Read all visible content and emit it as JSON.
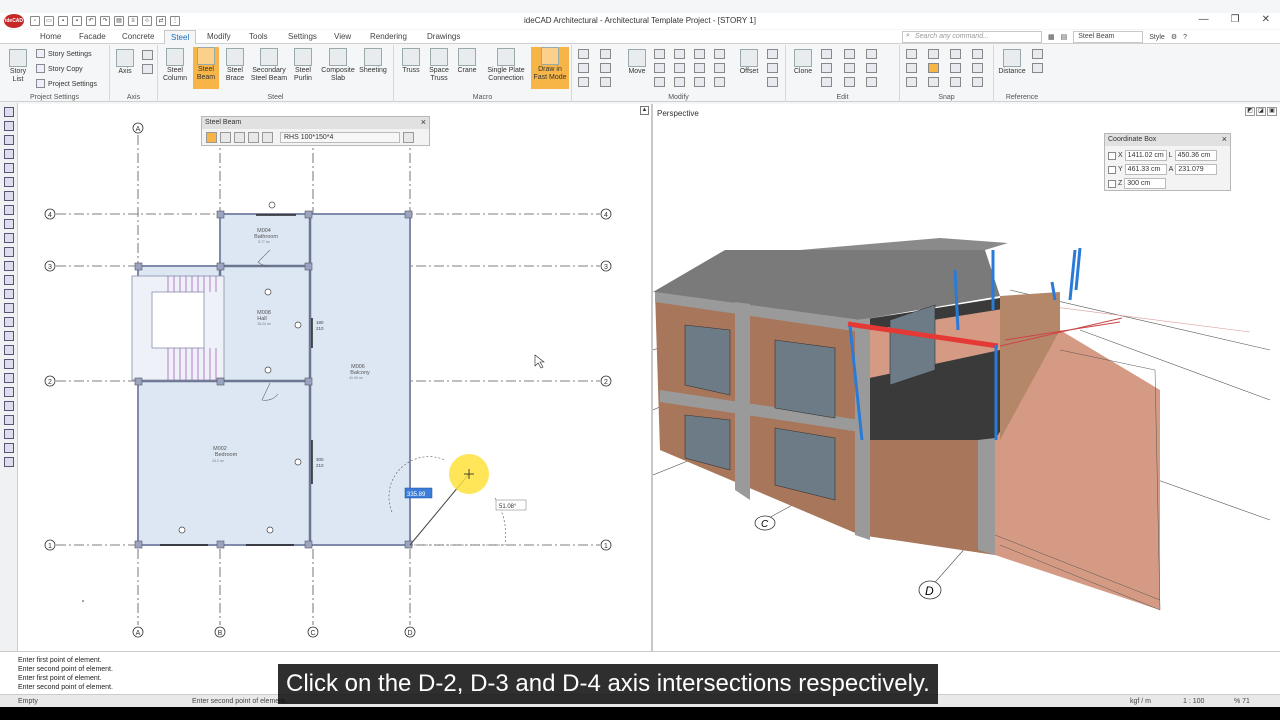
{
  "app": {
    "title": "ideCAD Architectural - Architectural Template Project - [STORY 1]",
    "logo_text": "ideCAD",
    "window_controls": [
      "—",
      "❐",
      "✕"
    ]
  },
  "tabs": [
    "Home",
    "Facade",
    "Concrete",
    "Steel",
    "Modify",
    "Tools",
    "Settings",
    "View",
    "Rendering",
    "Drawings"
  ],
  "active_tab": "Steel",
  "search": {
    "placeholder": "Search any command..."
  },
  "right_tools": {
    "selector_value": "Steel Beam",
    "style_label": "Style"
  },
  "ribbon": {
    "project_settings": {
      "label": "Project Settings",
      "story_list": "Story List",
      "story_settings": "Story Settings",
      "story_copy": "Story Copy",
      "project_settings_btn": "Project Settings"
    },
    "axis": {
      "label": "Axis",
      "axis_btn": "Axis"
    },
    "steel": {
      "label": "Steel",
      "buttons": [
        "Steel Column",
        "Steel Beam",
        "Steel Brace",
        "Secondary Steel Beam",
        "Steel Purlin",
        "Composite Slab",
        "Sheeting"
      ]
    },
    "macro": {
      "label": "Macro",
      "buttons": [
        "Truss",
        "Space Truss",
        "Crane",
        "Single Plate Connection",
        "Draw in Fast Mode"
      ]
    },
    "modify": {
      "label": "Modify",
      "move": "Move",
      "offset": "Offset"
    },
    "edit": {
      "label": "Edit",
      "clone": "Clone"
    },
    "snap": {
      "label": "Snap"
    },
    "reference": {
      "label": "Reference",
      "distance": "Distance"
    }
  },
  "steel_beam_panel": {
    "title": "Steel Beam",
    "section": "RHS 100*150*4"
  },
  "coordinate_box": {
    "title": "Coordinate Box",
    "x_label": "X",
    "x_value": "1411.02 cm",
    "y_label": "Y",
    "y_value": "461.33 cm",
    "z_label": "Z",
    "z_value": "300 cm",
    "l_label": "L",
    "l_value": "450.36 cm",
    "a_label": "A",
    "a_value": "231.079"
  },
  "plan": {
    "axes_vertical": [
      "A",
      "B",
      "C",
      "D"
    ],
    "axes_horizontal": [
      "1",
      "2",
      "3",
      "4"
    ],
    "rooms": [
      {
        "code": "M004",
        "name": "Bathroom",
        "area": "5.77 m²"
      },
      {
        "code": "M008",
        "name": "Hall",
        "area": "15.24 m²"
      },
      {
        "code": "M006",
        "name": "Balcony",
        "area": "41.00 m²"
      },
      {
        "code": "M002",
        "name": "Bedroom",
        "area": "24.2 m²"
      }
    ],
    "length_input": "335.89",
    "angle_label": "51.08°",
    "window_dims": [
      "180\n210",
      "300\n210"
    ]
  },
  "perspective": {
    "label": "Perspective",
    "axis_labels": [
      "C",
      "D"
    ]
  },
  "command_log": [
    "Enter first point of element.",
    "Enter second point of element.",
    "Enter first point of element.",
    "Enter second point of element."
  ],
  "status": {
    "left": "Empty",
    "prompt": "Enter second point of element.",
    "units": "kgf / m",
    "scale": "1 : 100",
    "zoom": "% 71"
  },
  "caption": "Click on the D-2, D-3 and D-4 axis intersections respectively.",
  "colors": {
    "accent": "#f7b548",
    "beam_selected": "#e53935",
    "steel_blue": "#2a7bd8",
    "plan_fill": "#dde7f4"
  }
}
